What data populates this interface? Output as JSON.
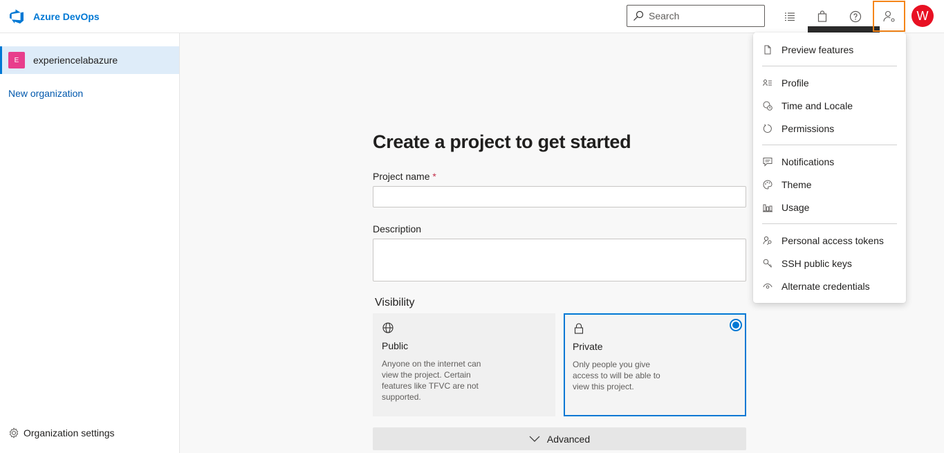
{
  "header": {
    "brand_name": "Azure DevOps",
    "search_placeholder": "Search",
    "avatar_initial": "W",
    "icons": [
      "task-list-icon",
      "marketplace-bag-icon",
      "help-icon",
      "user-settings-icon"
    ],
    "accent_color": "#0078d4",
    "highlight_color": "#f58518"
  },
  "sidebar": {
    "org": {
      "badge": "E",
      "name": "experiencelabazure"
    },
    "new_org_label": "New organization",
    "org_settings_label": "Organization settings"
  },
  "main": {
    "title": "Create a project to get started",
    "project_name_label": "Project name",
    "required_mark": "*",
    "description_label": "Description",
    "visibility_label": "Visibility",
    "visibility_options": [
      {
        "title": "Public",
        "description": "Anyone on the internet can view the project. Certain features like TFVC are not supported.",
        "selected": false,
        "icon": "globe-icon"
      },
      {
        "title": "Private",
        "description": "Only people you give access to will be able to view this project.",
        "selected": true,
        "icon": "lock-icon"
      }
    ],
    "advanced_label": "Advanced"
  },
  "user_menu": {
    "items": [
      {
        "label": "Preview features",
        "icon": "document-icon"
      },
      {
        "label": "Profile",
        "icon": "profile-card-icon"
      },
      {
        "label": "Time and Locale",
        "icon": "globe-clock-icon"
      },
      {
        "label": "Permissions",
        "icon": "refresh-circle-icon"
      },
      {
        "label": "Notifications",
        "icon": "chat-bubble-icon"
      },
      {
        "label": "Theme",
        "icon": "palette-icon"
      },
      {
        "label": "Usage",
        "icon": "bar-chart-icon"
      },
      {
        "label": "Personal access tokens",
        "icon": "people-key-icon"
      },
      {
        "label": "SSH public keys",
        "icon": "key-icon"
      },
      {
        "label": "Alternate credentials",
        "icon": "eye-icon"
      }
    ]
  }
}
